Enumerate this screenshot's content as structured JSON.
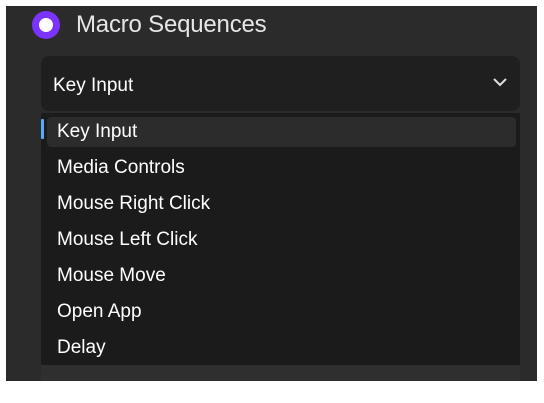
{
  "macro_section": {
    "title": "Macro Sequences",
    "radio_selected": true,
    "accent_color": "#7b33ff"
  },
  "action_select": {
    "value": "Key Input",
    "expanded": true,
    "options": [
      "Key Input",
      "Media Controls",
      "Mouse Right Click",
      "Mouse Left Click",
      "Mouse Move",
      "Open App",
      "Delay"
    ],
    "selected_index": 0
  },
  "icons": {
    "radio": "radio-selected-icon",
    "chevron": "chevron-down-icon"
  }
}
